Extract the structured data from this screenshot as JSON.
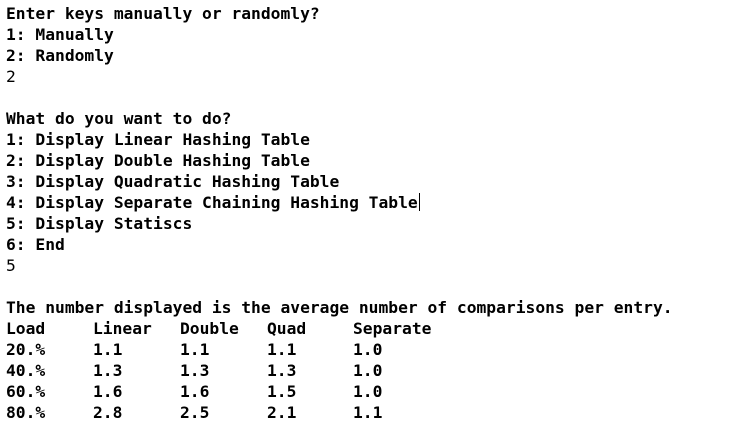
{
  "prompt1": {
    "question": "Enter keys manually or randomly?",
    "options": [
      "1: Manually",
      "2: Randomly"
    ],
    "answer": "2"
  },
  "prompt2": {
    "question": "What do you want to do?",
    "options": [
      "1: Display Linear Hashing Table",
      "2: Display Double Hashing Table",
      "3: Display Quadratic Hashing Table",
      "4: Display Separate Chaining Hashing Table",
      "5: Display Statiscs",
      "6: End"
    ],
    "answer": "5"
  },
  "stats": {
    "note": "The number displayed is the average number of comparisons per entry.",
    "headers": [
      "Load",
      "Linear",
      "Double",
      "Quad",
      "Separate"
    ],
    "rows": [
      [
        "20.%",
        "1.1",
        "1.1",
        "1.1",
        "1.0"
      ],
      [
        "40.%",
        "1.3",
        "1.3",
        "1.3",
        "1.0"
      ],
      [
        "60.%",
        "1.6",
        "1.6",
        "1.5",
        "1.0"
      ],
      [
        "80.%",
        "2.8",
        "2.5",
        "2.1",
        "1.1"
      ]
    ]
  }
}
